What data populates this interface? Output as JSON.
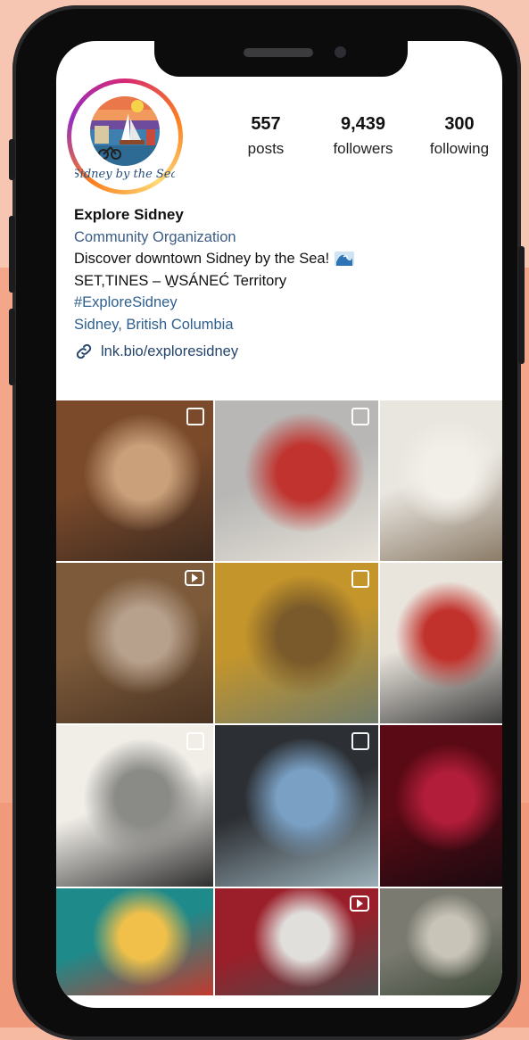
{
  "profile": {
    "avatar_caption": "Sidney by the Sea",
    "stats": [
      {
        "value": "557",
        "label": "posts"
      },
      {
        "value": "9,439",
        "label": "followers"
      },
      {
        "value": "300",
        "label": "following"
      }
    ],
    "name": "Explore Sidney",
    "category": "Community Organization",
    "bio_line1": "Discover downtown Sidney by the Sea!",
    "bio_line2": "SET,TINES – W̱SÁNEĆ Territory",
    "hashtag": "#ExploreSidney",
    "location": "Sidney, British Columbia",
    "link": "lnk.bio/exploresidney"
  },
  "grid": {
    "tiles": [
      {
        "label": "couple-in-shop",
        "badge": "multi",
        "colors": [
          "#7a4a2b",
          "#c9a07a",
          "#3d2a1f"
        ]
      },
      {
        "label": "pizza-storefront",
        "badge": "multi",
        "colors": [
          "#b8b7b5",
          "#c0332e",
          "#e8e3da"
        ]
      },
      {
        "label": "man-with-painting",
        "badge": "none",
        "colors": [
          "#e9e6e0",
          "#f2efe9",
          "#8a7a66"
        ]
      },
      {
        "label": "miniature-landmarks",
        "badge": "reel",
        "colors": [
          "#7c5a3a",
          "#b7a08c",
          "#4a3322"
        ]
      },
      {
        "label": "man-in-restaurant",
        "badge": "multi",
        "colors": [
          "#c4952b",
          "#7a5a2a",
          "#6f7b6a"
        ]
      },
      {
        "label": "clothing-boutique",
        "badge": "none",
        "colors": [
          "#e9e4dc",
          "#c2322d",
          "#3b3b3b"
        ]
      },
      {
        "label": "woman-in-store",
        "badge": "multi",
        "colors": [
          "#f1eee8",
          "#8a8a86",
          "#2e2e2e"
        ]
      },
      {
        "label": "airplane-window-view",
        "badge": "multi",
        "colors": [
          "#2c2f33",
          "#7aa0c4",
          "#9bb0b9"
        ]
      },
      {
        "label": "theatre-stage",
        "badge": "none",
        "colors": [
          "#5a0a14",
          "#b21d3a",
          "#1a0a10"
        ]
      },
      {
        "label": "woman-popcorn-shop",
        "badge": "none",
        "colors": [
          "#1f8a8a",
          "#f0c04a",
          "#c23a2e"
        ]
      },
      {
        "label": "beacon-books-storefront",
        "badge": "reel",
        "colors": [
          "#9a1f2a",
          "#e0dfdc",
          "#4a4a4a"
        ]
      },
      {
        "label": "cafe-interior",
        "badge": "none",
        "colors": [
          "#7a7a70",
          "#c9c4b8",
          "#3e4a3a"
        ]
      }
    ]
  },
  "icons": {
    "link": "link-icon",
    "wave": "wave-emoji-icon"
  }
}
